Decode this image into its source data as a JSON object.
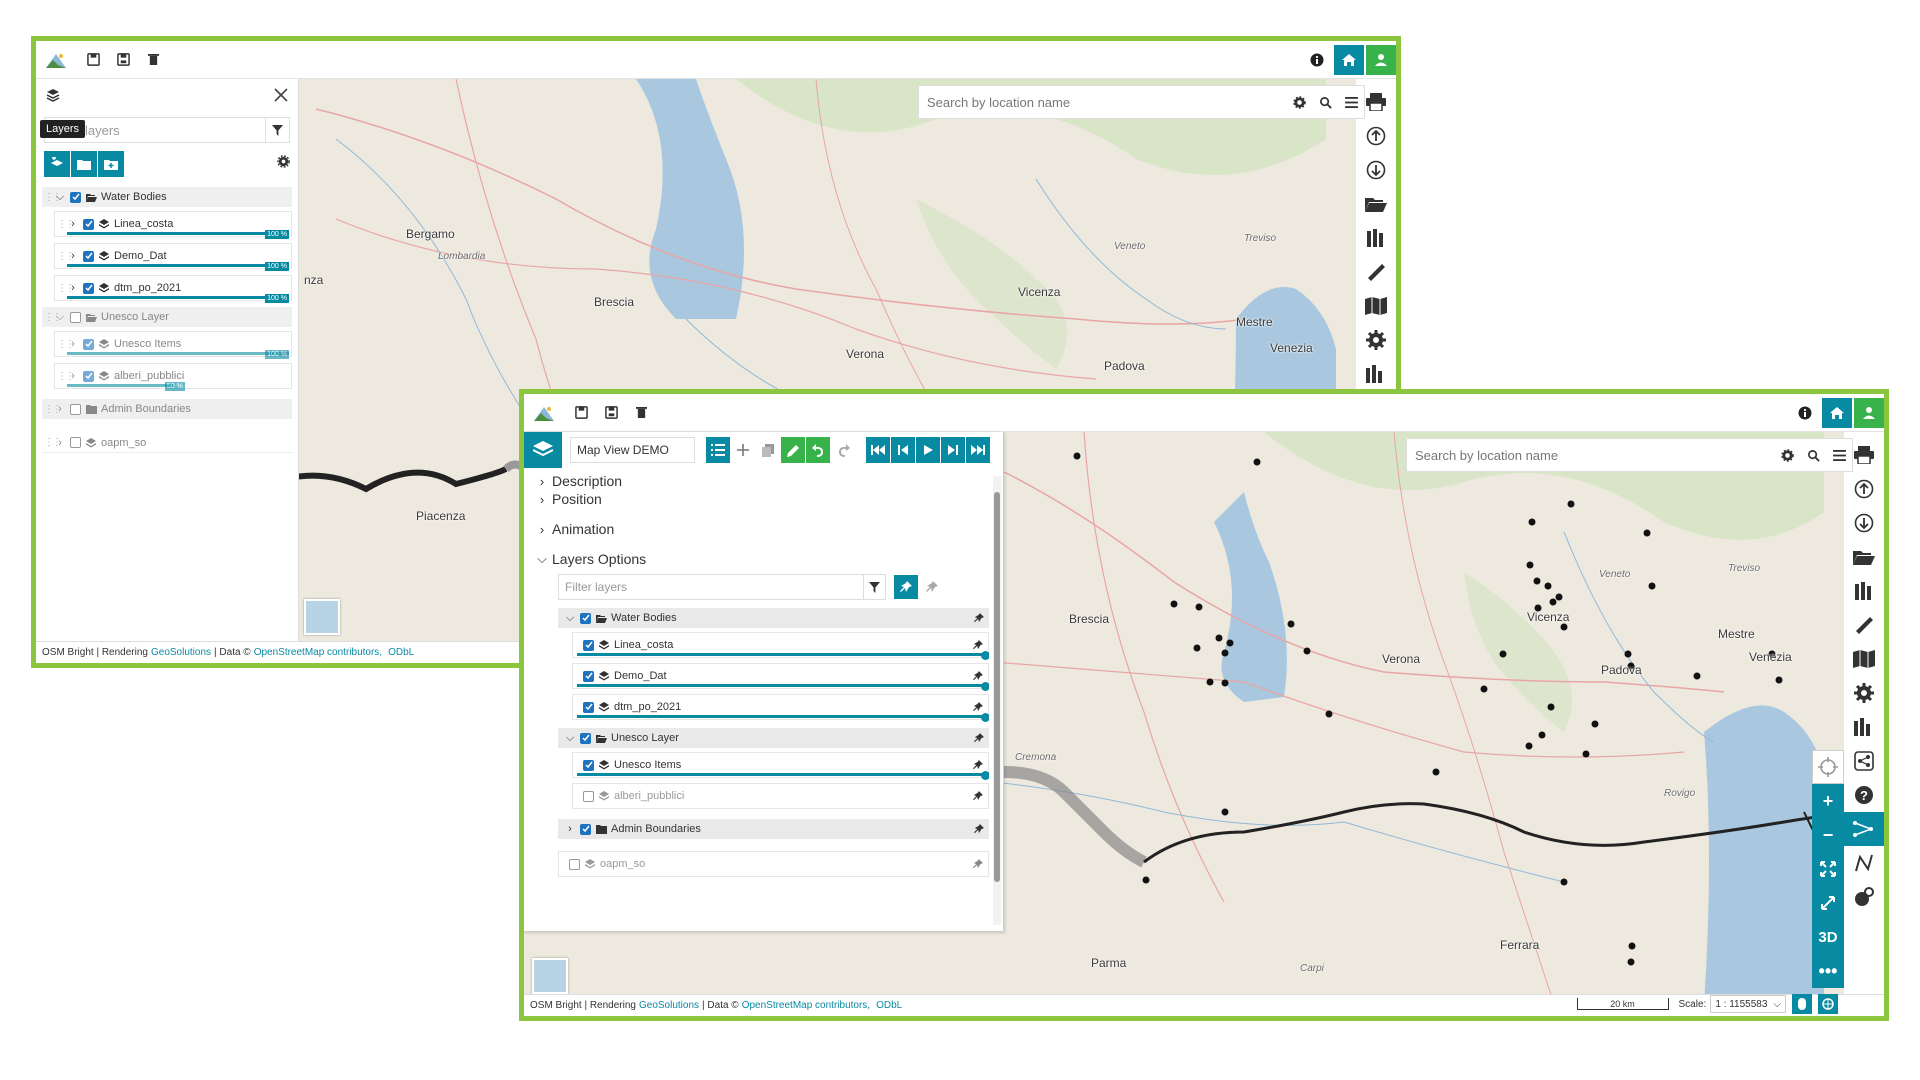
{
  "window1": {
    "search": {
      "placeholder": "Search by location name"
    },
    "tooltip": "Layers",
    "filter": {
      "placeholder": "layers"
    },
    "groups": [
      {
        "name": "Water Bodies",
        "checked": true,
        "layers": [
          {
            "name": "Linea_costa",
            "checked": true,
            "opacity": "100 %"
          },
          {
            "name": "Demo_Dat",
            "checked": true,
            "opacity": "100 %"
          },
          {
            "name": "dtm_po_2021",
            "checked": true,
            "opacity": "100 %"
          }
        ]
      },
      {
        "name": "Unesco Layer",
        "checked": false,
        "layers": [
          {
            "name": "Unesco Items",
            "checked": true,
            "opacity": "100 %"
          },
          {
            "name": "alberi_pubblici",
            "checked": true,
            "opacity": "50 %"
          }
        ]
      },
      {
        "name": "Admin Boundaries",
        "checked": false
      },
      {
        "name": "oapm_so",
        "checked": false
      }
    ],
    "map_labels": [
      "Bergamo",
      "Lombardia",
      "Brescia",
      "Verona",
      "Vicenza",
      "Veneto",
      "Treviso",
      "Mestre",
      "Venezia",
      "Padova",
      "Piacenza",
      "nza"
    ],
    "footer": {
      "a": "OSM Bright | Rendering",
      "link1": "GeoSolutions",
      "b": "| Data ©",
      "link2": "OpenStreetMap contributors,",
      "link3": "ODbL"
    }
  },
  "window2": {
    "search": {
      "placeholder": "Search by location name"
    },
    "map_view_title": "Map View DEMO",
    "sections": [
      "Description",
      "Position",
      "Animation",
      "Layers Options"
    ],
    "filter": {
      "placeholder": "Filter layers"
    },
    "groups": [
      {
        "name": "Water Bodies",
        "checked": true,
        "layers": [
          {
            "name": "Linea_costa",
            "checked": true
          },
          {
            "name": "Demo_Dat",
            "checked": true
          },
          {
            "name": "dtm_po_2021",
            "checked": true
          }
        ]
      },
      {
        "name": "Unesco Layer",
        "checked": true,
        "layers": [
          {
            "name": "Unesco Items",
            "checked": true
          },
          {
            "name": "alberi_pubblici",
            "checked": false
          }
        ]
      },
      {
        "name": "Admin Boundaries",
        "checked": true
      },
      {
        "name": "oapm_so",
        "checked": false
      }
    ],
    "map_labels": [
      "Brescia",
      "Vicenza",
      "Verona",
      "Veneto",
      "Treviso",
      "Mestre",
      "Venezia",
      "Padova",
      "Cremona",
      "Rovigo",
      "Parma",
      "Carpi",
      "Ferrara",
      "N"
    ],
    "zoom_3d": "3D",
    "scale": {
      "bar": "20 km",
      "label": "Scale:",
      "value": "1 : 1155583"
    },
    "footer": {
      "a": "OSM Bright | Rendering",
      "link1": "GeoSolutions",
      "b": "| Data ©",
      "link2": "OpenStreetMap contributors,",
      "link3": "ODbL"
    }
  }
}
